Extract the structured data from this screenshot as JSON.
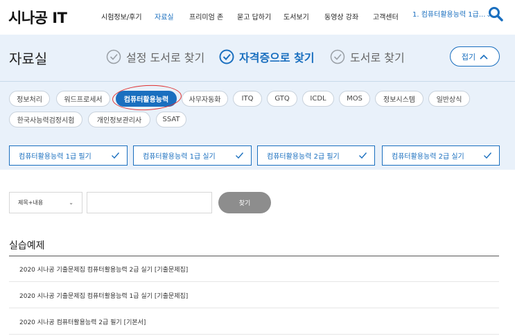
{
  "header": {
    "logo": "시나공 IT",
    "nav": [
      {
        "label": "시험정보/후기"
      },
      {
        "label": "자료실"
      },
      {
        "label": "프리미엄 존"
      },
      {
        "label": "묻고 답하기"
      },
      {
        "label": "도서보기"
      },
      {
        "label": "동영상 강좌"
      },
      {
        "label": "고객센터"
      }
    ],
    "rank_text": "1. 컴퓨터활용능력 1급...",
    "active_color": "#1a6fbf"
  },
  "band": {
    "title": "자료실",
    "modes": [
      {
        "label": "설정 도서로 찾기",
        "active": false
      },
      {
        "label": "자격증으로 찾기",
        "active": true
      },
      {
        "label": "도서로 찾기",
        "active": false
      }
    ],
    "fold_label": "접기",
    "chips": [
      {
        "label": "정보처리"
      },
      {
        "label": "워드프로세서"
      },
      {
        "label": "컴퓨터활용능력",
        "selected": true
      },
      {
        "label": "사무자동화"
      },
      {
        "label": "ITQ"
      },
      {
        "label": "GTQ"
      },
      {
        "label": "ICDL"
      },
      {
        "label": "MOS"
      },
      {
        "label": "정보시스템"
      },
      {
        "label": "일반상식"
      },
      {
        "label": "한국사능력검정시험"
      },
      {
        "label": "개인정보관리사"
      },
      {
        "label": "SSAT"
      }
    ],
    "sub_categories": [
      {
        "label": "컴퓨터활용능력 1급 필기"
      },
      {
        "label": "컴퓨터활용능력 1급 실기"
      },
      {
        "label": "컴퓨터활용능력 2급 필기"
      },
      {
        "label": "컴퓨터활용능력 2급 실기"
      }
    ]
  },
  "search": {
    "select_value": "제목+내용",
    "input_value": "",
    "button_label": "찾기"
  },
  "list": {
    "title": "실습예제",
    "items": [
      {
        "text": "2020 시나공 기출문제집 컴퓨터활용능력 2급 실기 [기출문제집]"
      },
      {
        "text": "2020 시나공 기출문제집 컴퓨터활용능력 1급 실기 [기출문제집]"
      },
      {
        "text": "2020 시나공 컴퓨터활용능력 2급 필기 [기본서]"
      }
    ]
  }
}
